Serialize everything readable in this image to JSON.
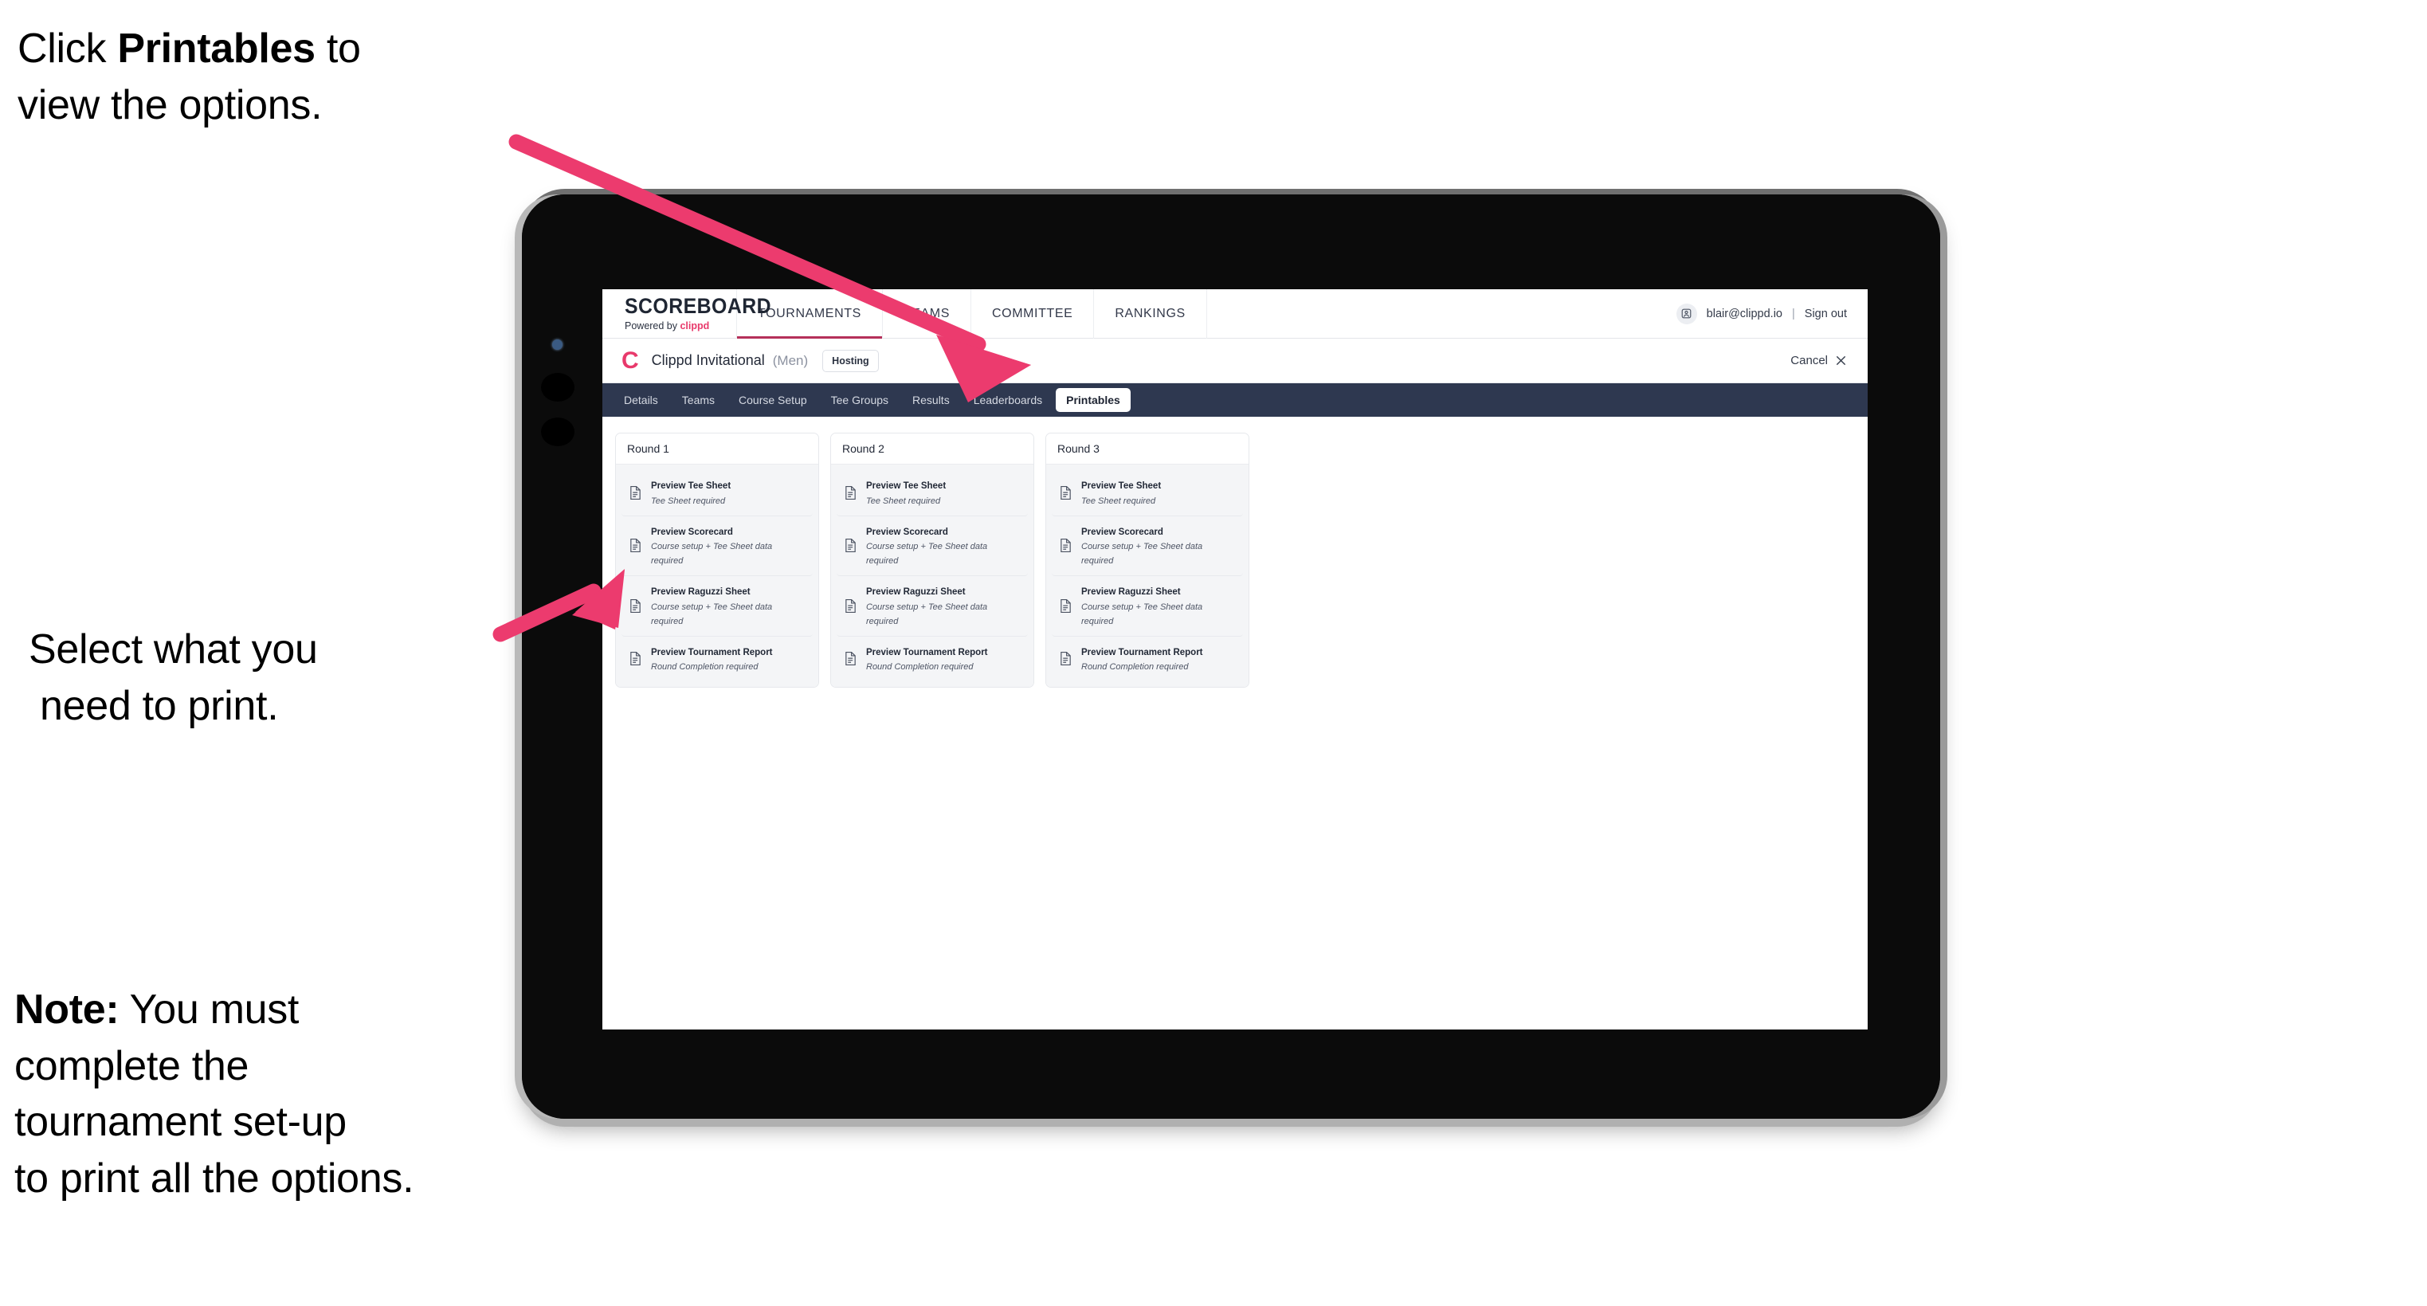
{
  "annotations": {
    "callout_top": {
      "pre": "Click ",
      "bold": "Printables",
      "post": " to",
      "line2": "view the options."
    },
    "callout_mid": {
      "line1": "Select what you",
      "line2": "need to print."
    },
    "note": {
      "label": "Note:",
      "line1_rest": " You must",
      "line2": "complete the",
      "line3": "tournament set-up",
      "line4": "to print all the options."
    }
  },
  "colors": {
    "accent_pink": "#e8396b",
    "arrow_pink": "#ec3b6e",
    "tabstrip_navy": "#2e3850",
    "text_dark": "#222937"
  },
  "app": {
    "brand": {
      "wordmark": "SCOREBOARD",
      "powered_prefix": "Powered by ",
      "powered_brand": "clippd"
    },
    "top_nav": [
      {
        "label": "TOURNAMENTS",
        "active": true
      },
      {
        "label": "TEAMS",
        "active": false
      },
      {
        "label": "COMMITTEE",
        "active": false
      },
      {
        "label": "RANKINGS",
        "active": false
      }
    ],
    "account": {
      "avatar_icon": "user-avatar-icon",
      "email": "blair@clippd.io",
      "separator": "|",
      "sign_out": "Sign out"
    },
    "subheader": {
      "logo_letter": "C",
      "tournament_name": "Clippd Invitational",
      "gender": "(Men)",
      "badge": "Hosting",
      "cancel_label": "Cancel",
      "close_icon": "close-icon"
    },
    "tabs": [
      {
        "label": "Details",
        "active": false
      },
      {
        "label": "Teams",
        "active": false
      },
      {
        "label": "Course Setup",
        "active": false
      },
      {
        "label": "Tee Groups",
        "active": false
      },
      {
        "label": "Results",
        "active": false
      },
      {
        "label": "Leaderboards",
        "active": false
      },
      {
        "label": "Printables",
        "active": true
      }
    ],
    "rounds": [
      {
        "title": "Round 1",
        "items": [
          {
            "icon": "document-icon",
            "title": "Preview Tee Sheet",
            "subtitle": "Tee Sheet required"
          },
          {
            "icon": "document-icon",
            "title": "Preview Scorecard",
            "subtitle": "Course setup + Tee Sheet data required"
          },
          {
            "icon": "document-icon",
            "title": "Preview Raguzzi Sheet",
            "subtitle": "Course setup + Tee Sheet data required"
          },
          {
            "icon": "document-icon",
            "title": "Preview Tournament Report",
            "subtitle": "Round Completion required"
          }
        ]
      },
      {
        "title": "Round 2",
        "items": [
          {
            "icon": "document-icon",
            "title": "Preview Tee Sheet",
            "subtitle": "Tee Sheet required"
          },
          {
            "icon": "document-icon",
            "title": "Preview Scorecard",
            "subtitle": "Course setup + Tee Sheet data required"
          },
          {
            "icon": "document-icon",
            "title": "Preview Raguzzi Sheet",
            "subtitle": "Course setup + Tee Sheet data required"
          },
          {
            "icon": "document-icon",
            "title": "Preview Tournament Report",
            "subtitle": "Round Completion required"
          }
        ]
      },
      {
        "title": "Round 3",
        "items": [
          {
            "icon": "document-icon",
            "title": "Preview Tee Sheet",
            "subtitle": "Tee Sheet required"
          },
          {
            "icon": "document-icon",
            "title": "Preview Scorecard",
            "subtitle": "Course setup + Tee Sheet data required"
          },
          {
            "icon": "document-icon",
            "title": "Preview Raguzzi Sheet",
            "subtitle": "Course setup + Tee Sheet data required"
          },
          {
            "icon": "document-icon",
            "title": "Preview Tournament Report",
            "subtitle": "Round Completion required"
          }
        ]
      }
    ]
  }
}
